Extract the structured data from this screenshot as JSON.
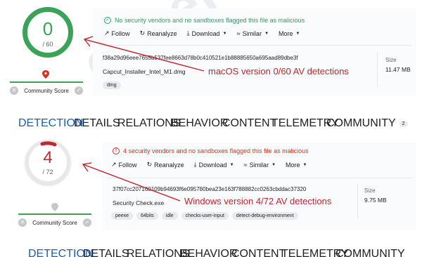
{
  "panels": [
    {
      "score": {
        "value": "0",
        "total": "/ 60",
        "ring_color": "#3aa357"
      },
      "community": {
        "label": "Community Score",
        "line_color": "#3aa357",
        "marker_color": "#d93025"
      },
      "status": {
        "text": "No security vendors and no sandboxes flagged this file as malicious",
        "icon": "✓",
        "kind": "ok"
      },
      "actions": [
        {
          "icon": "↗",
          "label": "Follow",
          "caret": false
        },
        {
          "icon": "↻",
          "label": "Reanalyze",
          "caret": false
        },
        {
          "icon": "⤓",
          "label": "Download",
          "caret": true
        },
        {
          "icon": "≈",
          "label": "Similar",
          "caret": true
        },
        {
          "icon": "",
          "label": "More",
          "caret": true
        }
      ],
      "hash": "f38a29d96eee7655b537fee8663d78b0c410521e1b88885650a695aad89dbe3f",
      "filename": "Capcut_Installer_Intel_M1.dmg",
      "tags": [
        "dmg"
      ],
      "size": {
        "label": "Size",
        "value": "11.47 MB"
      },
      "annotation": "macOS version 0/60 AV detections",
      "tabs": [
        {
          "label": "DETECTION",
          "active": true
        },
        {
          "label": "DETAILS",
          "active": false
        },
        {
          "label": "RELATIONS",
          "active": false
        },
        {
          "label": "BEHAVIOR",
          "active": false
        },
        {
          "label": "CONTENT",
          "active": false
        },
        {
          "label": "TELEMETRY",
          "active": false
        },
        {
          "label": "COMMUNITY",
          "active": false,
          "count": "2"
        }
      ]
    },
    {
      "score": {
        "value": "4",
        "total": "/ 72",
        "ring_color": "#c0282e"
      },
      "community": {
        "label": "Community Score",
        "line_color": "#3aa357",
        "marker_color": "#c4c7cb"
      },
      "status": {
        "text": "4 security vendors and no sandboxes flagged this file as malicious",
        "icon": "!",
        "kind": "bad"
      },
      "actions": [
        {
          "icon": "↗",
          "label": "Follow",
          "caret": false
        },
        {
          "icon": "↻",
          "label": "Reanalyze",
          "caret": false
        },
        {
          "icon": "⤓",
          "label": "Download",
          "caret": true
        },
        {
          "icon": "≈",
          "label": "Similar",
          "caret": true
        },
        {
          "icon": "",
          "label": "More",
          "caret": true
        }
      ],
      "hash": "37f07cc207160109b94693f6e095780bea23e163f788882cc0263cbddac37320",
      "filename": "Security Check.exe",
      "tags": [
        "peexe",
        "64bits",
        "idle",
        "checks-user-input",
        "detect-debug-environment"
      ],
      "size": {
        "label": "Size",
        "value": "9.75 MB"
      },
      "annotation": "Windows version 4/72 AV detections",
      "tabs": [
        {
          "label": "DETECTION",
          "active": true
        },
        {
          "label": "DETAILS",
          "active": false
        },
        {
          "label": "RELATIONS",
          "active": false
        },
        {
          "label": "BEHAVIOR",
          "active": false
        },
        {
          "label": "CONTENT",
          "active": false
        },
        {
          "label": "TELEMETRY",
          "active": false
        },
        {
          "label": "COMMUNITY",
          "active": false
        }
      ]
    }
  ],
  "watermark": "cyberby.net",
  "colors": {
    "annotation": "#c0252c",
    "tab_active": "#1a5fb4"
  }
}
